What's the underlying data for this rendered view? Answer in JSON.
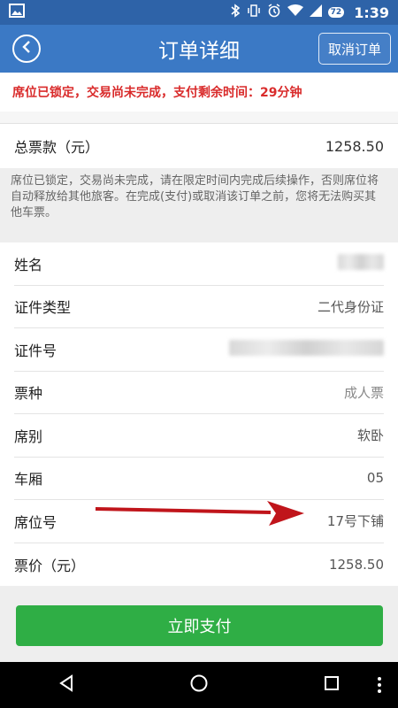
{
  "status_bar": {
    "time": "1:39",
    "battery": "72"
  },
  "header": {
    "title": "订单详细",
    "cancel_label": "取消订单"
  },
  "alert": {
    "text": "席位已锁定，交易尚未完成，支付剩余时间：29分钟"
  },
  "total": {
    "label": "总票款（元）",
    "value": "1258.50"
  },
  "notice": {
    "text": "席位已锁定，交易尚未完成，请在限定时间内完成后续操作，否则席位将自动释放给其他旅客。在完成(支付)或取消该订单之前，您将无法购买其他车票。"
  },
  "passenger": {
    "name": {
      "label": "姓名"
    },
    "id_type": {
      "label": "证件类型",
      "value": "二代身份证"
    },
    "id_no": {
      "label": "证件号"
    },
    "ticket_type": {
      "label": "票种",
      "value": "成人票"
    },
    "seat_class": {
      "label": "席别",
      "value": "软卧"
    },
    "car": {
      "label": "车厢",
      "value": "05"
    },
    "seat_no": {
      "label": "席位号",
      "value": "17号下铺"
    },
    "price": {
      "label": "票价（元）",
      "value": "1258.50"
    }
  },
  "pay_button": {
    "label": "立即支付"
  },
  "colors": {
    "header_blue": "#3b79c5",
    "status_blue": "#2e63a8",
    "alert_red": "#d92b2b",
    "pay_green": "#2fae45",
    "arrow_red": "#c0151b"
  },
  "icons": [
    "image-icon",
    "bluetooth-icon",
    "vibrate-icon",
    "alarm-icon",
    "wifi-icon",
    "signal-icon",
    "battery-icon",
    "back-icon",
    "nav-back-icon",
    "nav-home-icon",
    "nav-recents-icon",
    "more-icon",
    "arrow-annotation"
  ]
}
